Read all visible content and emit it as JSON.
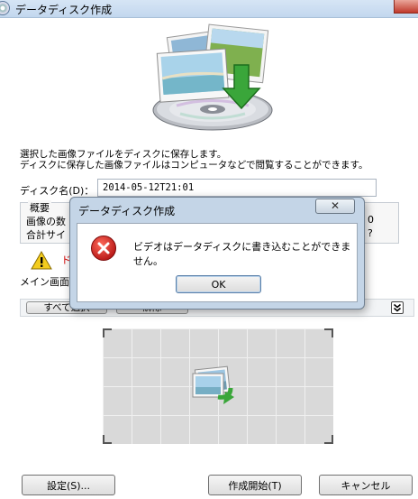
{
  "window": {
    "title": "データディスク作成",
    "icon": "disc-app-icon"
  },
  "description": {
    "line1": "選択した画像ファイルをディスクに保存します。",
    "line2": "ディスクに保存した画像ファイルはコンピュータなどで閲覧することができます。"
  },
  "disc_name": {
    "label": "ディスク名(D)：",
    "value": "2014-05-12T21:01"
  },
  "overview": {
    "heading": "概要",
    "row1_label": "画像の数",
    "row2_label": "合計サイ",
    "row1_tail": "0",
    "row2_tail": "?"
  },
  "warning": {
    "icon": "warning-triangle-icon",
    "text": "ド"
  },
  "main_screen_text": "メイン画面が",
  "toolbar": {
    "select_all_label": "すべて選択",
    "deselect_label": "解除",
    "expand_icon": "double-chevron-down-icon"
  },
  "preview": {
    "icon": "photo-rotate-icon"
  },
  "buttons": {
    "settings": "設定(S)...",
    "start": "作成開始(T)",
    "cancel": "キャンセル"
  },
  "dialog": {
    "title": "データディスク作成",
    "close_glyph": "✕",
    "icon": "error-icon",
    "message": "ビデオはデータディスクに書き込むことができません。",
    "ok_label": "OK"
  },
  "colors": {
    "error_red": "#c81818",
    "warning_yellow": "#f3cc1e",
    "dialog_frame": "#c4d5e7",
    "arrow_green": "#3aa63a"
  }
}
